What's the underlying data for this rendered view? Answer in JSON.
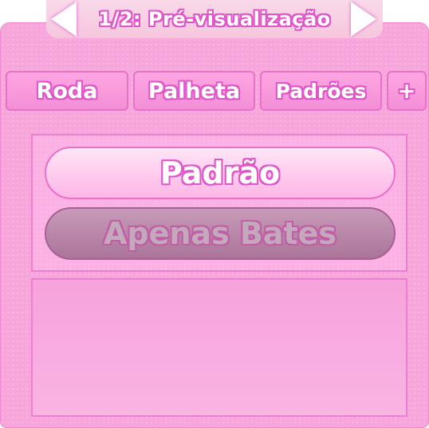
{
  "header": {
    "title": "1/2: Pré-visualização",
    "prev_icon": "arrow-left-icon",
    "next_icon": "arrow-right-icon"
  },
  "tabs": [
    {
      "label": "Roda"
    },
    {
      "label": "Palheta"
    },
    {
      "label": "Padrões"
    },
    {
      "label": "+"
    }
  ],
  "options": {
    "default_label": "Padrão",
    "only_hits_label": "Apenas Bates"
  },
  "colors": {
    "panel": "#f8a5dc",
    "accent_outline": "#e055c8",
    "disabled": "#aa7599"
  }
}
